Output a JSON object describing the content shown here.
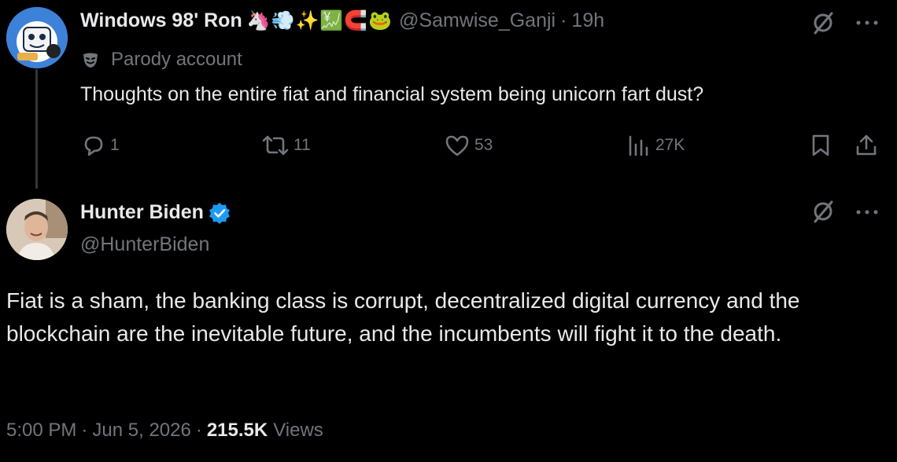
{
  "parent_tweet": {
    "display_name": "Windows 98' Ron",
    "name_emojis": "🦄💨✨💹🧲🐸",
    "handle": "@Samwise_Ganji",
    "separator": "·",
    "time": "19h",
    "parody_label": "Parody account",
    "text": "Thoughts on the entire fiat and financial system being unicorn fart dust?",
    "actions": {
      "replies": "1",
      "reposts": "11",
      "likes": "53",
      "views": "27K"
    }
  },
  "main_tweet": {
    "display_name": "Hunter Biden",
    "handle": "@HunterBiden",
    "text": "Fiat is a sham, the banking class is corrupt, decentralized digital currency and the blockchain are the inevitable future, and the incumbents will fight it to the death.",
    "time": "5:00 PM",
    "separator1": "·",
    "date": "Jun 5, 2026",
    "separator2": "·",
    "views_count": "215.5K",
    "views_label": "Views"
  },
  "colors": {
    "background": "#000000",
    "primary_text": "#e7e9ea",
    "muted_text": "#71767b",
    "verified_blue": "#1d9bf0",
    "thread_line": "#333639"
  },
  "icons": [
    "grok-icon",
    "more-icon",
    "reply-icon",
    "repost-icon",
    "like-icon",
    "views-icon",
    "bookmark-icon",
    "share-icon",
    "verified-badge-icon",
    "parody-mask-icon"
  ]
}
